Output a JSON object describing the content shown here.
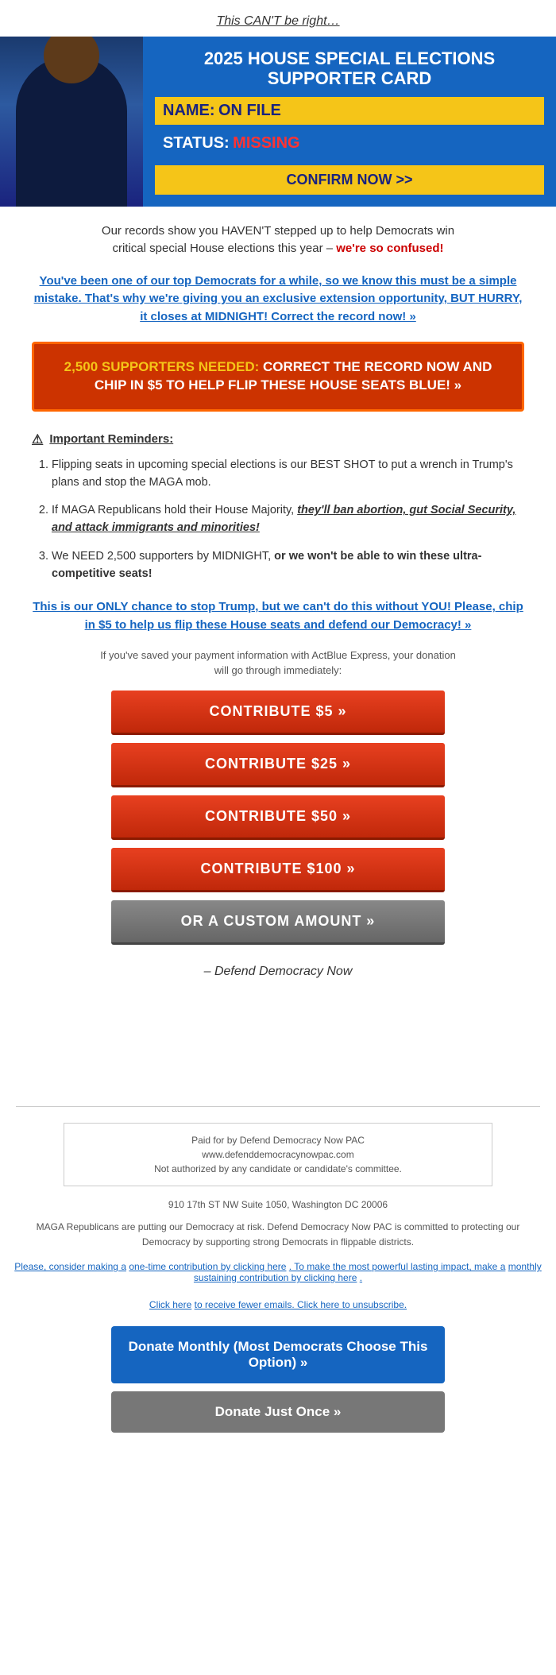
{
  "header": {
    "title": "This CAN'T be right…"
  },
  "hero": {
    "top_line1": "2025 HOUSE SPECIAL ELECTIONS",
    "top_line2": "SUPPORTER CARD",
    "name_label": "NAME:",
    "name_value": "ON FILE",
    "status_label": "STATUS:",
    "status_value": "MISSING",
    "confirm_text": "CONFIRM NOW >>"
  },
  "intro": {
    "line1": "Our records show you HAVEN'T stepped up to help Democrats win",
    "line2": "critical special House elections this year –",
    "confused": "we're so confused!",
    "link_text": "You've been one of our top Democrats for a while, so we know this must be a simple mistake. That's why we're giving you an exclusive extension opportunity, BUT HURRY, it closes at MIDNIGHT! Correct the record now! »"
  },
  "cta_box": {
    "highlight": "2,500 SUPPORTERS NEEDED:",
    "text": " CORRECT THE RECORD NOW AND CHIP IN $5 TO HELP FLIP THESE HOUSE SEATS BLUE! »"
  },
  "reminders": {
    "header": "Important Reminders:",
    "items": [
      {
        "text_normal": "Flipping seats in upcoming special elections is our BEST SHOT to put a wrench in Trump's plans and stop the MAGA mob.",
        "italic_part": "",
        "bold_part": ""
      },
      {
        "text_before": "If MAGA Republicans hold their House Majority, ",
        "italic_part": "they'll ban abortion, gut Social Security, and attack immigrants and minorities!",
        "text_after": ""
      },
      {
        "text_before": "We NEED 2,500 supporters by MIDNIGHT, ",
        "bold_part": "or we won't be able to win these ultra-competitive seats!",
        "text_after": ""
      }
    ]
  },
  "final_appeal": "This is our ONLY chance to stop Trump, but we can't do this without YOU! Please, chip in $5 to help us flip these House seats and defend our Democracy! »",
  "payment_info": {
    "line1": "If you've saved your payment information with ActBlue Express, your donation",
    "line2": "will go through immediately:"
  },
  "donate_buttons": [
    {
      "label": "CONTRIBUTE $5 »",
      "type": "red"
    },
    {
      "label": "CONTRIBUTE $25 »",
      "type": "red"
    },
    {
      "label": "CONTRIBUTE $50 »",
      "type": "red"
    },
    {
      "label": "CONTRIBUTE $100 »",
      "type": "red"
    },
    {
      "label": "OR A CUSTOM AMOUNT »",
      "type": "gray"
    }
  ],
  "signature": "– Defend Democracy Now",
  "footer": {
    "legal_line1": "Paid for by Defend Democracy Now PAC",
    "legal_line2": "www.defenddemocracynowpac.com",
    "legal_line3": "Not authorized by any candidate or candidate's committee.",
    "address": "910 17th ST NW Suite 1050, Washington DC 20006",
    "disclaimer": "MAGA Republicans are putting our Democracy at risk. Defend Democracy Now PAC is committed to protecting our Democracy by supporting strong Democrats in flippable districts.",
    "links_text1": "Please, consider making a",
    "links_link1": "one-time contribution by clicking here",
    "links_text2": ". To make the most powerful lasting impact, make a",
    "links_link2": "monthly sustaining contribution by clicking here",
    "links_text3": ".",
    "unsubscribe_text1": "Click here",
    "unsubscribe_text2": "to receive fewer emails. Click here to unsubscribe."
  },
  "bottom_buttons": [
    {
      "label": "Donate Monthly (Most Democrats Choose This Option) »",
      "type": "blue"
    },
    {
      "label": "Donate Just Once »",
      "type": "gray"
    }
  ]
}
